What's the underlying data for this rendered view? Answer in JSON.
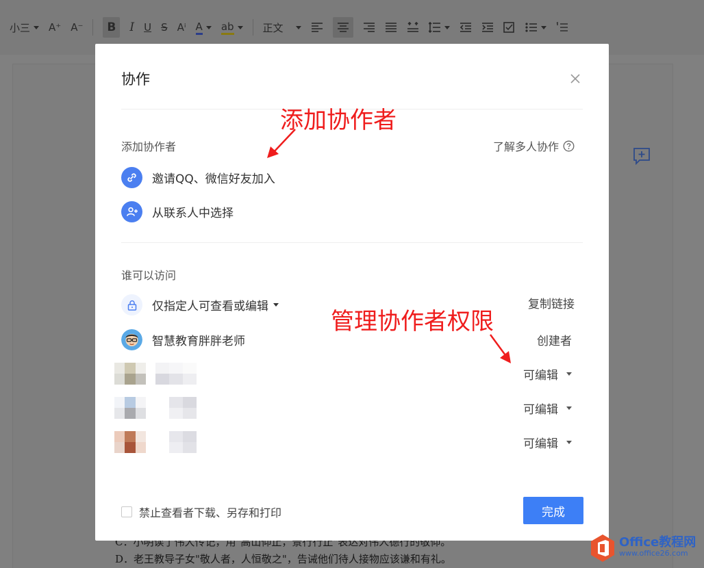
{
  "toolbar": {
    "font_size": "小三",
    "grow_label": "A⁺",
    "shrink_label": "A⁻",
    "bold": "B",
    "italic": "I",
    "underline": "U",
    "strike": "S",
    "superscript": "Aⁱ",
    "font_color": "A",
    "highlight": "ab",
    "style": "正文"
  },
  "document": {
    "line_c": "C．小明读了伟大传记，用\"高山仰止，景行行止\"表达对伟人德行的敬仰。",
    "line_d": "D．老王教导子女\"敬人者，人恒敬之\"，告诫他们待人接物应该谦和有礼。"
  },
  "dialog": {
    "title": "协作",
    "add_section": {
      "label": "添加协作者",
      "learn_more": "了解多人协作",
      "invite_label": "邀请QQ、微信好友加入",
      "contacts_label": "从联系人中选择"
    },
    "access_section": {
      "label": "谁可以访问",
      "permission_label": "仅指定人可查看或编辑",
      "copy_link": "复制链接"
    },
    "members": [
      {
        "name": "智慧教育胖胖老师",
        "role": "创建者"
      },
      {
        "name": "",
        "role": "可编辑"
      },
      {
        "name": "",
        "role": "可编辑"
      },
      {
        "name": "",
        "role": "可编辑"
      }
    ],
    "footer": {
      "restrict_label": "禁止查看者下载、另存和打印",
      "done_label": "完成"
    }
  },
  "annotations": {
    "add_collaborator": "添加协作者",
    "manage_permissions": "管理协作者权限"
  },
  "watermark": {
    "line1": "Office教程网",
    "line2": "www.office26.com"
  },
  "colors": {
    "accent": "#3d7ff6",
    "annotation": "#ef1d1d",
    "overlay": "#808080"
  }
}
